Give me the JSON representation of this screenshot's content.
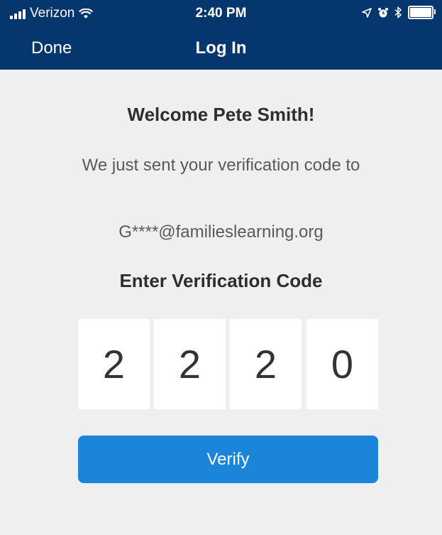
{
  "status_bar": {
    "carrier": "Verizon",
    "time": "2:40 PM",
    "wifi_icon": "wifi-icon",
    "location_icon": "location-arrow-icon",
    "alarm_icon": "alarm-icon",
    "bluetooth_icon": "bluetooth-icon",
    "battery_level": 1.0
  },
  "nav": {
    "done_label": "Done",
    "title": "Log In"
  },
  "main": {
    "welcome": "Welcome Pete Smith!",
    "message": "We just sent your verification code to",
    "email": "G****@familieslearning.org",
    "code_label": "Enter Verification Code",
    "code_digits": [
      "2",
      "2",
      "2",
      "0"
    ],
    "verify_label": "Verify"
  },
  "colors": {
    "header_bg": "#05366e",
    "page_bg": "#efeff0",
    "button_bg": "#1b86d9"
  }
}
